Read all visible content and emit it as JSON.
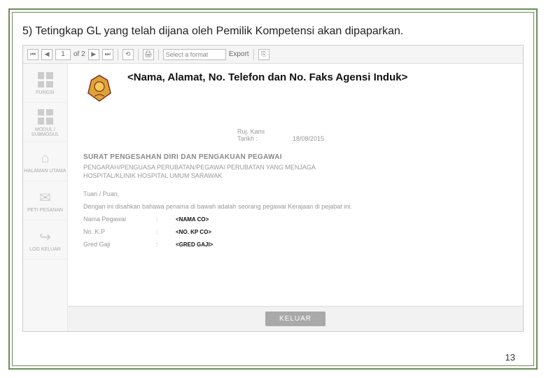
{
  "instruction": "5) Tetingkap GL yang telah dijana oleh Pemilik Kompetensi akan dipaparkan.",
  "toolbar": {
    "first": "⏮",
    "prev": "◀",
    "page_cur": "1",
    "page_of": "of 2",
    "next": "▶",
    "last": "⏭",
    "format_label": "Select a format",
    "export_label": "Export"
  },
  "sidebar": {
    "items": [
      {
        "label": "FUNGSI"
      },
      {
        "label": "MODUL / SUBMODUL"
      },
      {
        "label": "HALAMAN UTAMA"
      },
      {
        "label": "PETI PESANAN"
      },
      {
        "label": "LOG KELUAR"
      }
    ]
  },
  "document": {
    "address_placeholder": "<Nama, Alamat, No. Telefon dan No. Faks Agensi Induk>",
    "ref_label": "Ruj. Kami",
    "ref_val": "",
    "date_label": "Tarikh :",
    "date_val": "18/08/2015",
    "title": "SURAT PENGESAHAN DIRI DAN PENGAKUAN PEGAWAI",
    "line2": "PENGARAH/PENGUASA PERUBATAN/PEGAWAI PERUBATAN YANG MENJAGA",
    "line3": "HOSPITAL/KLINIK HOSPITAL UMUM SARAWAK",
    "greeting": "Tuan / Puan,",
    "intro": "Dengan ini disahkan bahawa penama di bawah adalah seorang pegawai Kerajaan di pejabat ini.",
    "rows": [
      {
        "label": "Nama Pegawai",
        "value": "<NAMA CO>"
      },
      {
        "label": "No. K.P",
        "value": "<NO. KP CO>"
      },
      {
        "label": "Gred Gaji",
        "value": "<GRED GAJI>"
      }
    ]
  },
  "footer": {
    "keluar": "KELUAR"
  },
  "page_number": "13"
}
